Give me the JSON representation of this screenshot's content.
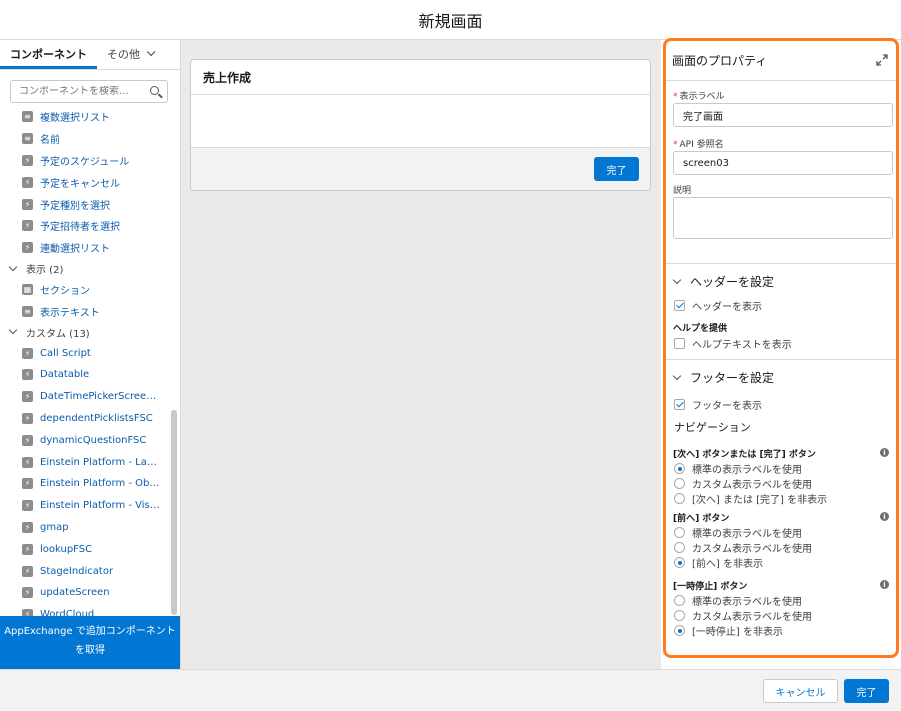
{
  "modal": {
    "title": "新規画面"
  },
  "left_panel": {
    "tabs": [
      {
        "label": "コンポーネント"
      },
      {
        "label": "その他"
      }
    ],
    "search_placeholder": "コンポーネントを検索...",
    "items": [
      {
        "type": "item",
        "label": "複数選択リスト",
        "icon": "picklist-icon"
      },
      {
        "type": "item",
        "label": "名前",
        "icon": "name-icon"
      },
      {
        "type": "item",
        "label": "予定のスケジュール",
        "icon": "lightning-icon"
      },
      {
        "type": "item",
        "label": "予定をキャンセル",
        "icon": "lightning-icon"
      },
      {
        "type": "item",
        "label": "予定種別を選択",
        "icon": "lightning-icon"
      },
      {
        "type": "item",
        "label": "予定招待者を選択",
        "icon": "lightning-icon"
      },
      {
        "type": "item",
        "label": "連動選択リスト",
        "icon": "lightning-icon"
      },
      {
        "type": "category",
        "label": "表示 (2)"
      },
      {
        "type": "item",
        "label": "セクション",
        "icon": "section-icon"
      },
      {
        "type": "item",
        "label": "表示テキスト",
        "icon": "text-icon"
      },
      {
        "type": "category",
        "label": "カスタム (13)"
      },
      {
        "type": "item",
        "label": "Call Script",
        "icon": "lightning-icon"
      },
      {
        "type": "item",
        "label": "Datatable",
        "icon": "lightning-icon"
      },
      {
        "type": "item",
        "label": "DateTimePickerScreenC...",
        "icon": "lightning-icon"
      },
      {
        "type": "item",
        "label": "dependentPicklistsFSC",
        "icon": "lightning-icon"
      },
      {
        "type": "item",
        "label": "dynamicQuestionFSC",
        "icon": "lightning-icon"
      },
      {
        "type": "item",
        "label": "Einstein Platform - Lang...",
        "icon": "lightning-icon"
      },
      {
        "type": "item",
        "label": "Einstein Platform - Objec...",
        "icon": "lightning-icon"
      },
      {
        "type": "item",
        "label": "Einstein Platform - Vision",
        "icon": "lightning-icon"
      },
      {
        "type": "item",
        "label": "gmap",
        "icon": "lightning-icon"
      },
      {
        "type": "item",
        "label": "lookupFSC",
        "icon": "lightning-icon"
      },
      {
        "type": "item",
        "label": "StageIndicator",
        "icon": "lightning-icon"
      },
      {
        "type": "item",
        "label": "updateScreen",
        "icon": "lightning-icon"
      },
      {
        "type": "item",
        "label": "WordCloud",
        "icon": "lightning-icon"
      }
    ],
    "appexchange_label": "AppExchange で追加コンポーネントを取得"
  },
  "canvas": {
    "screen_title": "売上作成",
    "done_label": "完了"
  },
  "properties": {
    "title": "画面のプロパティ",
    "display_label": {
      "label": "表示ラベル",
      "value": "完了画面"
    },
    "api_name": {
      "label": "API 参照名",
      "value": "screen03"
    },
    "description": {
      "label": "説明"
    },
    "header_section": {
      "title": "ヘッダーを設定",
      "show_header": "ヘッダーを表示",
      "help_title": "ヘルプを提供",
      "show_help": "ヘルプテキストを表示"
    },
    "footer_section": {
      "title": "フッターを設定",
      "show_footer": "フッターを表示",
      "navigation": "ナビゲーション",
      "next_group": {
        "title": "[次へ] ボタンまたは [完了] ボタン",
        "options": [
          "標準の表示ラベルを使用",
          "カスタム表示ラベルを使用",
          "[次へ] または [完了] を非表示"
        ],
        "selected": 0
      },
      "prev_group": {
        "title": "[前へ] ボタン",
        "options": [
          "標準の表示ラベルを使用",
          "カスタム表示ラベルを使用",
          "[前へ] を非表示"
        ],
        "selected": 2
      },
      "pause_group": {
        "title": "[一時停止] ボタン",
        "options": [
          "標準の表示ラベルを使用",
          "カスタム表示ラベルを使用",
          "[一時停止] を非表示"
        ],
        "selected": 2
      }
    }
  },
  "footer": {
    "cancel_label": "キャンセル",
    "done_label": "完了"
  },
  "colors": {
    "brand": "#0176d3",
    "highlight": "#ff7a1a"
  }
}
